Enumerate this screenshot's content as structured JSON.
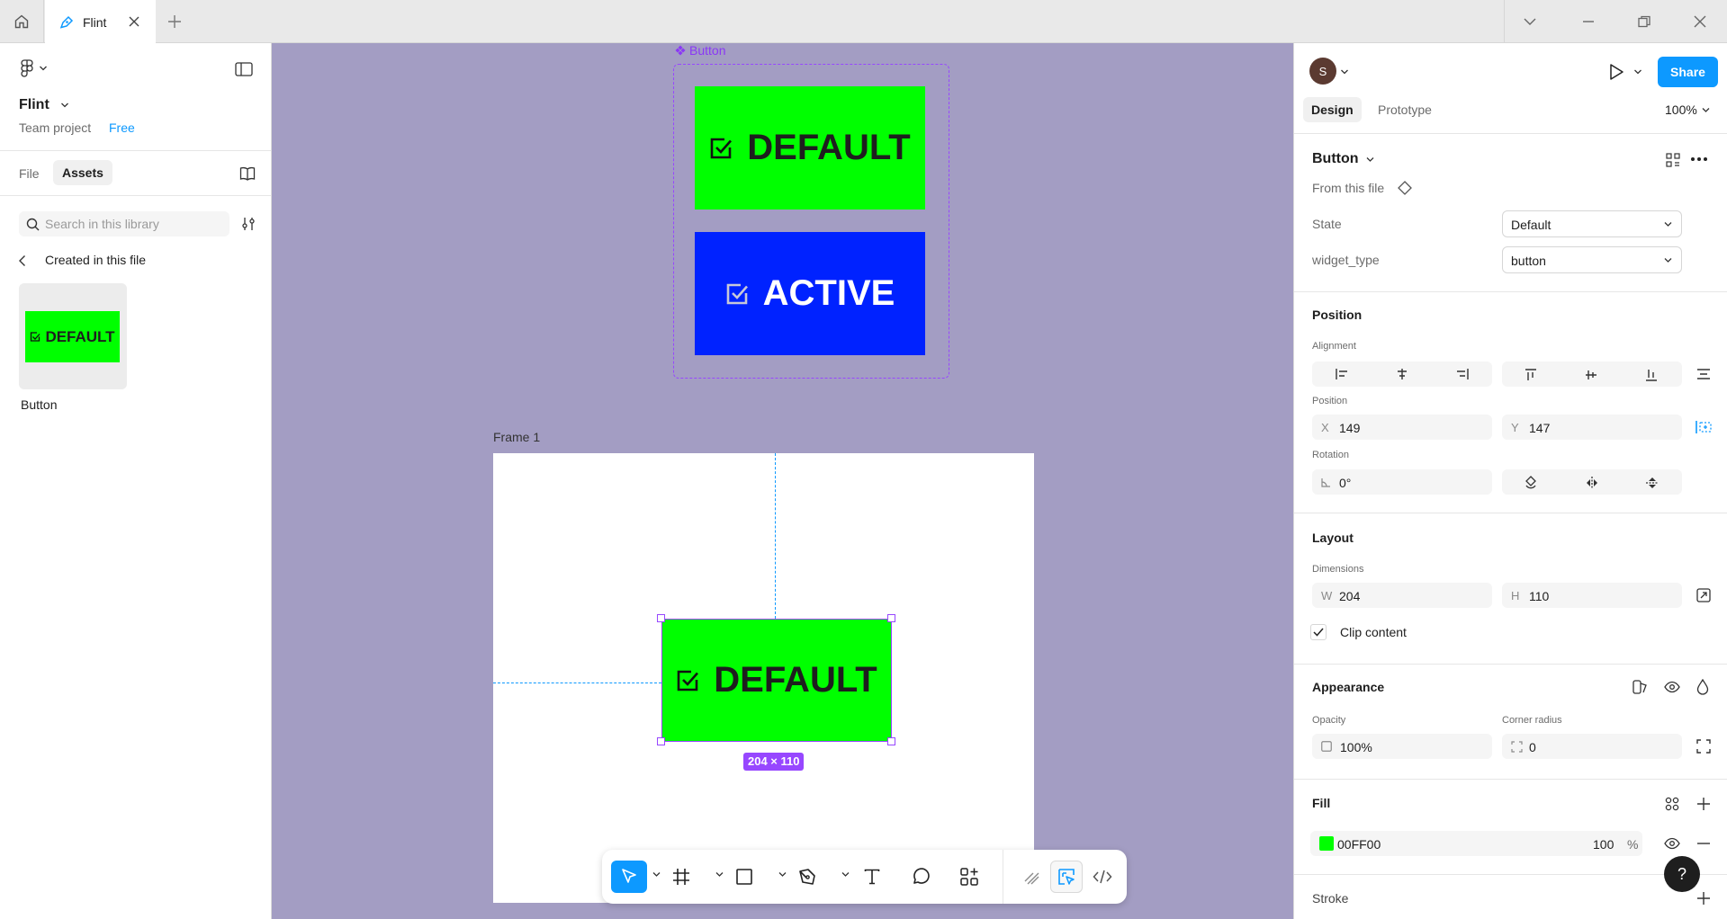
{
  "tabs": {
    "file_name": "Flint"
  },
  "left_panel": {
    "project_name": "Flint",
    "team_project": "Team project",
    "plan": "Free",
    "tab_file": "File",
    "tab_assets": "Assets",
    "search_placeholder": "Search in this library",
    "created_in_file": "Created in this file",
    "asset_thumb_text": "DEFAULT",
    "asset_name": "Button"
  },
  "canvas": {
    "component_set_label": "Button",
    "variant_default": "DEFAULT",
    "variant_active": "ACTIVE",
    "frame_label": "Frame 1",
    "instance_text": "DEFAULT",
    "dimension_badge": "204 × 110",
    "colors": {
      "default": "#00ff00",
      "active": "#0022ff",
      "canvas_bg": "#a39dc3"
    }
  },
  "right_panel": {
    "avatar_initial": "S",
    "share": "Share",
    "tab_design": "Design",
    "tab_prototype": "Prototype",
    "zoom": "100%",
    "component_name": "Button",
    "from_file": "From this file",
    "props": [
      {
        "label": "State",
        "value": "Default"
      },
      {
        "label": "widget_type",
        "value": "button"
      }
    ],
    "position": {
      "heading": "Position",
      "alignment_label": "Alignment",
      "position_label": "Position",
      "x_label": "X",
      "x": "149",
      "y_label": "Y",
      "y": "147",
      "rotation_label": "Rotation",
      "rotation": "0°"
    },
    "layout": {
      "heading": "Layout",
      "dimensions_label": "Dimensions",
      "w_label": "W",
      "w": "204",
      "h_label": "H",
      "h": "110",
      "clip_content": "Clip content"
    },
    "appearance": {
      "heading": "Appearance",
      "opacity_label": "Opacity",
      "opacity": "100%",
      "corner_label": "Corner radius",
      "corner": "0"
    },
    "fill": {
      "heading": "Fill",
      "hex": "00FF00",
      "opacity": "100",
      "unit": "%",
      "color": "#00ff00"
    },
    "stroke": {
      "heading": "Stroke"
    },
    "help": "?"
  }
}
